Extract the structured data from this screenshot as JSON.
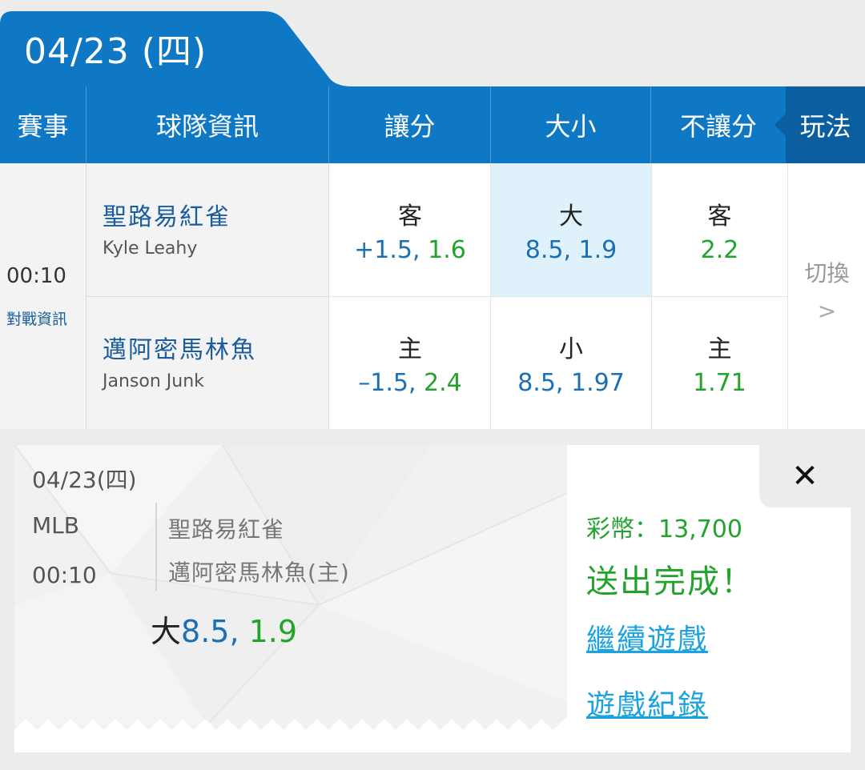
{
  "date_tab": {
    "label": "04/23 (四)"
  },
  "header": {
    "event": "賽事",
    "team_info": "球隊資訊",
    "handicap": "讓分",
    "over_under": "大小",
    "moneyline": "不讓分",
    "play_mode": "玩法"
  },
  "match": {
    "time": "00:10",
    "vs_info": "對戰資訊",
    "away": {
      "name": "聖路易紅雀",
      "pitcher": "Kyle Leahy"
    },
    "home": {
      "name": "邁阿密馬林魚",
      "pitcher": "Janson Junk"
    },
    "handicap": {
      "away_label": "客",
      "away_line": "+1.5,",
      "away_odds": "1.6",
      "home_label": "主",
      "home_line": "–1.5,",
      "home_odds": "2.4"
    },
    "over_under": {
      "over_label": "大",
      "over_line": "8.5,",
      "over_odds": "1.9",
      "under_label": "小",
      "under_line": "8.5,",
      "under_odds": "1.97"
    },
    "moneyline": {
      "away_label": "客",
      "away_odds": "2.2",
      "home_label": "主",
      "home_odds": "1.71"
    },
    "switch": {
      "label": "切換",
      "arrow": ">"
    }
  },
  "slip": {
    "date": "04/23(四)",
    "league": "MLB",
    "time": "00:10",
    "away": "聖路易紅雀",
    "home": "邁阿密馬林魚(主)",
    "pick_label": "大",
    "pick_line": "8.5,",
    "pick_odds": "1.9",
    "close": "✕",
    "credit": "彩幣：13,700",
    "status": "送出完成！",
    "continue_link": "繼續遊戲",
    "history_link": "遊戲紀錄"
  },
  "colors": {
    "primary_blue": "#0f78c5",
    "odds_green": "#22a32c",
    "line_blue": "#1b6fb5",
    "link_blue": "#1aa3e0",
    "selected_bg": "#dff2fb"
  }
}
